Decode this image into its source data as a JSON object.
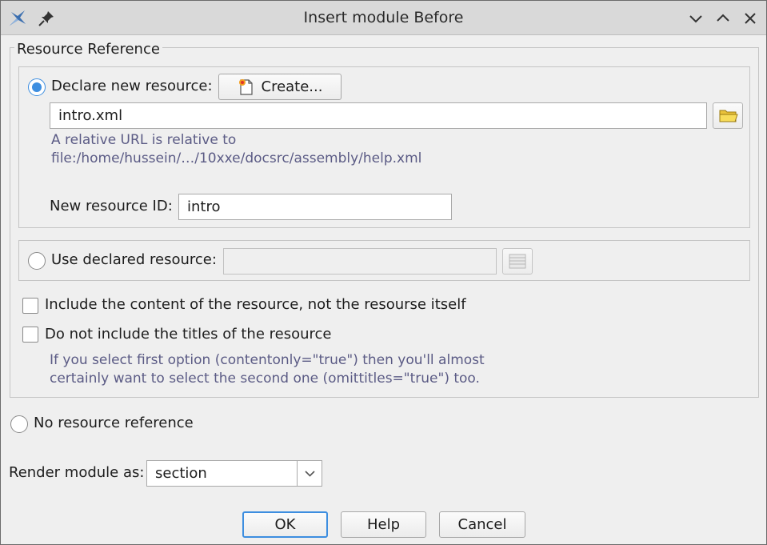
{
  "window": {
    "title": "Insert module Before"
  },
  "resource_reference": {
    "group_title": "Resource Reference",
    "declare_new": {
      "radio_label": "Declare new resource:",
      "selected": true,
      "create_button": "Create...",
      "url_value": "intro.xml",
      "hint_line1": "A relative URL is relative to",
      "hint_line2": "file:/home/hussein/…/10xxe/docsrc/assembly/help.xml",
      "id_label": "New resource ID:",
      "id_value": "intro"
    },
    "use_declared": {
      "radio_label": "Use declared resource:",
      "selected": false,
      "value": ""
    },
    "include_content": {
      "label": "Include the content of the resource, not the resourse itself",
      "checked": false
    },
    "omit_titles": {
      "label": "Do not include the titles of the resource",
      "checked": false
    },
    "options_hint_line1": "If you select first option (contentonly=\"true\") then you'll almost",
    "options_hint_line2": "certainly want to select the second one (omittitles=\"true\") too."
  },
  "no_reference": {
    "label": "No resource reference",
    "selected": false
  },
  "render": {
    "label": "Render module as:",
    "value": "section"
  },
  "buttons": {
    "ok": "OK",
    "help": "Help",
    "cancel": "Cancel"
  },
  "colors": {
    "accent": "#3d8ee0",
    "hint": "#5b5b85",
    "background": "#efefef"
  }
}
